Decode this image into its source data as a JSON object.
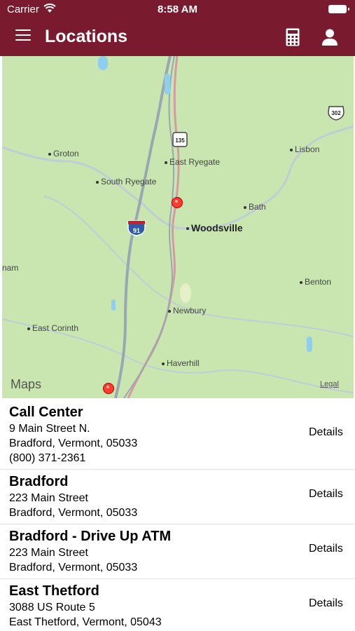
{
  "status_bar": {
    "carrier": "Carrier",
    "time": "8:58 AM"
  },
  "header": {
    "title": "Locations"
  },
  "map": {
    "places": [
      {
        "label": "Groton"
      },
      {
        "label": "East Ryegate"
      },
      {
        "label": "Lisbon"
      },
      {
        "label": "South Ryegate"
      },
      {
        "label": "Bath"
      },
      {
        "label": "Woodsville"
      },
      {
        "label": "nam"
      },
      {
        "label": "Benton"
      },
      {
        "label": "Newbury"
      },
      {
        "label": "East Corinth"
      },
      {
        "label": "Haverhill"
      }
    ],
    "shields": {
      "interstate": "91",
      "route_135": "135",
      "route_302": "302"
    },
    "attribution": "Maps",
    "legal": "Legal"
  },
  "locations": [
    {
      "name": "Call Center",
      "address1": "9 Main Street N.",
      "address2": "Bradford, Vermont, 05033",
      "phone": "(800) 371-2361",
      "details": "Details"
    },
    {
      "name": "Bradford",
      "address1": "223 Main Street",
      "address2": "Bradford, Vermont, 05033",
      "details": "Details"
    },
    {
      "name": "Bradford - Drive Up ATM",
      "address1": "223 Main Street",
      "address2": "Bradford, Vermont, 05033",
      "details": "Details"
    },
    {
      "name": "East Thetford",
      "address1": "3088 US Route 5",
      "address2": "East Thetford, Vermont, 05043",
      "details": "Details"
    }
  ]
}
